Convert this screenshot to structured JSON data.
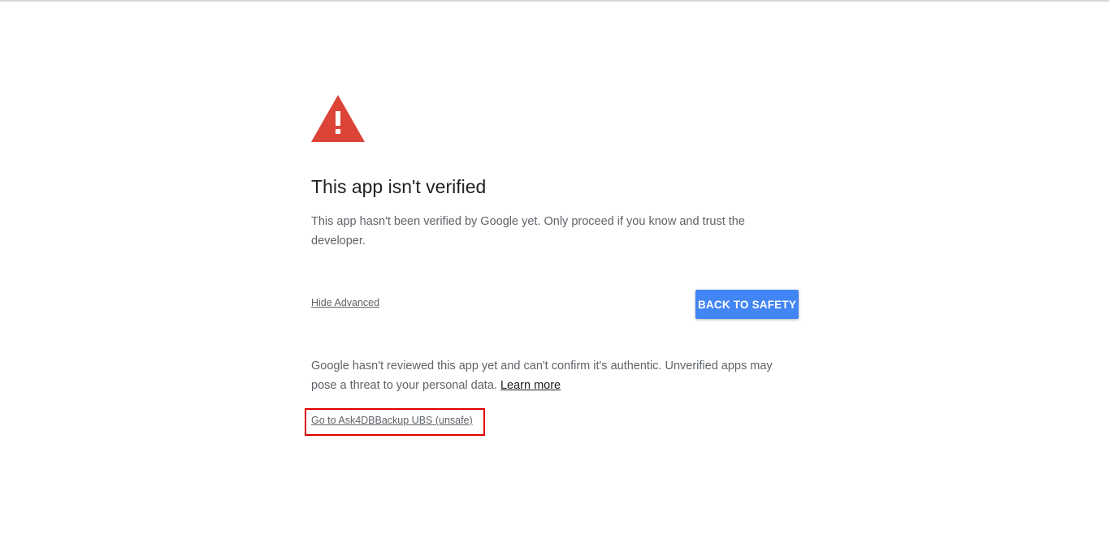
{
  "page": {
    "title": "This app isn't verified",
    "description": "This app hasn't been verified by Google yet. Only proceed if you know and trust the developer.",
    "hide_advanced": "Hide Advanced",
    "back_button": "BACK TO SAFETY",
    "details_text": "Google hasn't reviewed this app yet and can't confirm it's authentic. Unverified apps may pose a threat to your personal data. ",
    "learn_more": "Learn more",
    "proceed_link": "Go to Ask4DBBackup UBS (unsafe)"
  },
  "icons": {
    "warning": "warning-triangle-icon"
  },
  "colors": {
    "warning_red": "#db4437",
    "button_blue": "#4285f4",
    "highlight_red": "#e00000"
  }
}
